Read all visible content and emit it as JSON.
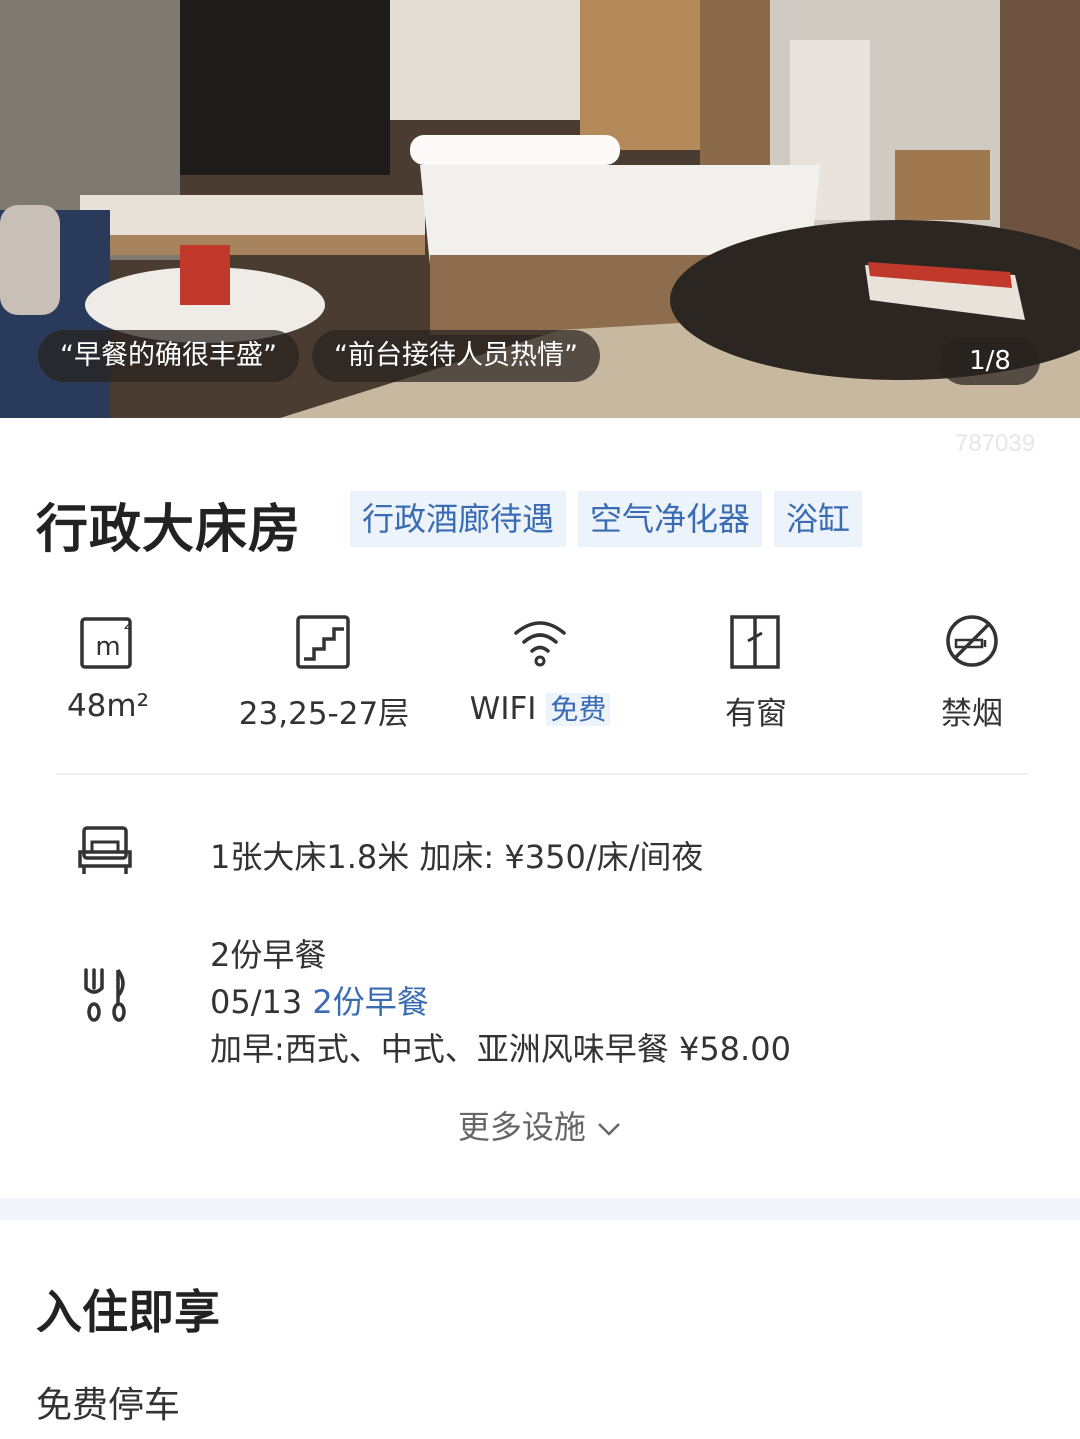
{
  "hero": {
    "review_tags": [
      "“早餐的确很丰盛”",
      "“前台接待人员热情”"
    ],
    "photo_counter": "1/8",
    "watermark": "787039"
  },
  "room": {
    "name": "行政大床房",
    "tags": [
      "行政酒廊待遇",
      "空气净化器",
      "浴缸"
    ]
  },
  "facilities": [
    {
      "icon": "area-icon",
      "label": "48m²"
    },
    {
      "icon": "floor-stairs-icon",
      "label": "23,25-27层"
    },
    {
      "icon": "wifi-icon",
      "label": "WIFI",
      "badge": "免费"
    },
    {
      "icon": "window-icon",
      "label": "有窗"
    },
    {
      "icon": "no-smoking-icon",
      "label": "禁烟"
    }
  ],
  "bed": {
    "icon": "bed-icon",
    "text": "1张大床1.8米  加床: ¥350/床/间夜"
  },
  "breakfast": {
    "icon": "utensils-icon",
    "line1": "2份早餐",
    "date": "05/13",
    "highlight": "2份早餐",
    "extra": "加早:西式、中式、亚洲风味早餐  ¥58.00"
  },
  "more_label": "更多设施",
  "section": {
    "title": "入住即享",
    "perk": "免费停车"
  },
  "colors": {
    "accent": "#3a6cb4",
    "tag_bg": "#edf3fb"
  }
}
